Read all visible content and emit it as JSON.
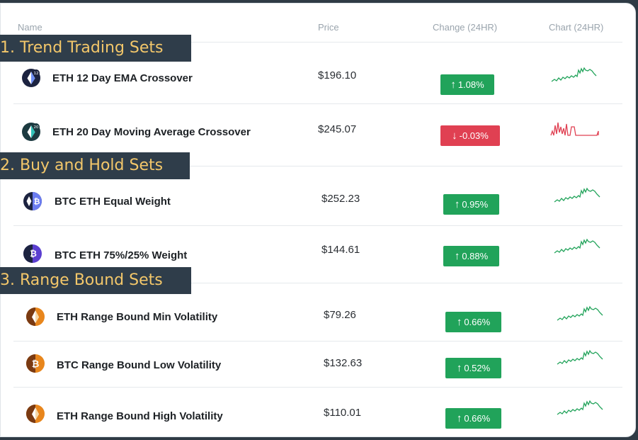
{
  "headers": {
    "name": "Name",
    "price": "Price",
    "change": "Change (24HR)",
    "chart": "Chart (24HR)"
  },
  "sections": [
    {
      "label": "1. Trend Trading Sets"
    },
    {
      "label": "2. Buy and Hold Sets"
    },
    {
      "label": "3. Range Bound Sets"
    }
  ],
  "rows": [
    {
      "name": "ETH 12 Day EMA Crossover",
      "price": "$196.10",
      "change": "1.08%",
      "direction": "up",
      "icon": "eth-12-ema-icon",
      "badge_num": "12"
    },
    {
      "name": "ETH 20 Day Moving Average Crossover",
      "price": "$245.07",
      "change": "-0.03%",
      "direction": "down",
      "icon": "eth-20-ma-icon",
      "badge_num": "20"
    },
    {
      "name": "BTC ETH Equal Weight",
      "price": "$252.23",
      "change": "0.95%",
      "direction": "up",
      "icon": "btc-eth-equal-icon"
    },
    {
      "name": "BTC ETH 75%/25% Weight",
      "price": "$144.61",
      "change": "0.88%",
      "direction": "up",
      "icon": "btc-eth-75-25-icon"
    },
    {
      "name": "ETH Range Bound Min Volatility",
      "price": "$79.26",
      "change": "0.66%",
      "direction": "up",
      "icon": "eth-range-min-icon"
    },
    {
      "name": "BTC Range Bound Low Volatility",
      "price": "$132.63",
      "change": "0.52%",
      "direction": "up",
      "icon": "btc-range-low-icon"
    },
    {
      "name": "ETH Range Bound High Volatility",
      "price": "$110.01",
      "change": "0.66%",
      "direction": "up",
      "icon": "eth-range-high-icon"
    }
  ],
  "colors": {
    "up": "#21a35a",
    "down": "#e04052",
    "section_bg": "#2f3d4a",
    "section_text": "#f3c76a"
  }
}
